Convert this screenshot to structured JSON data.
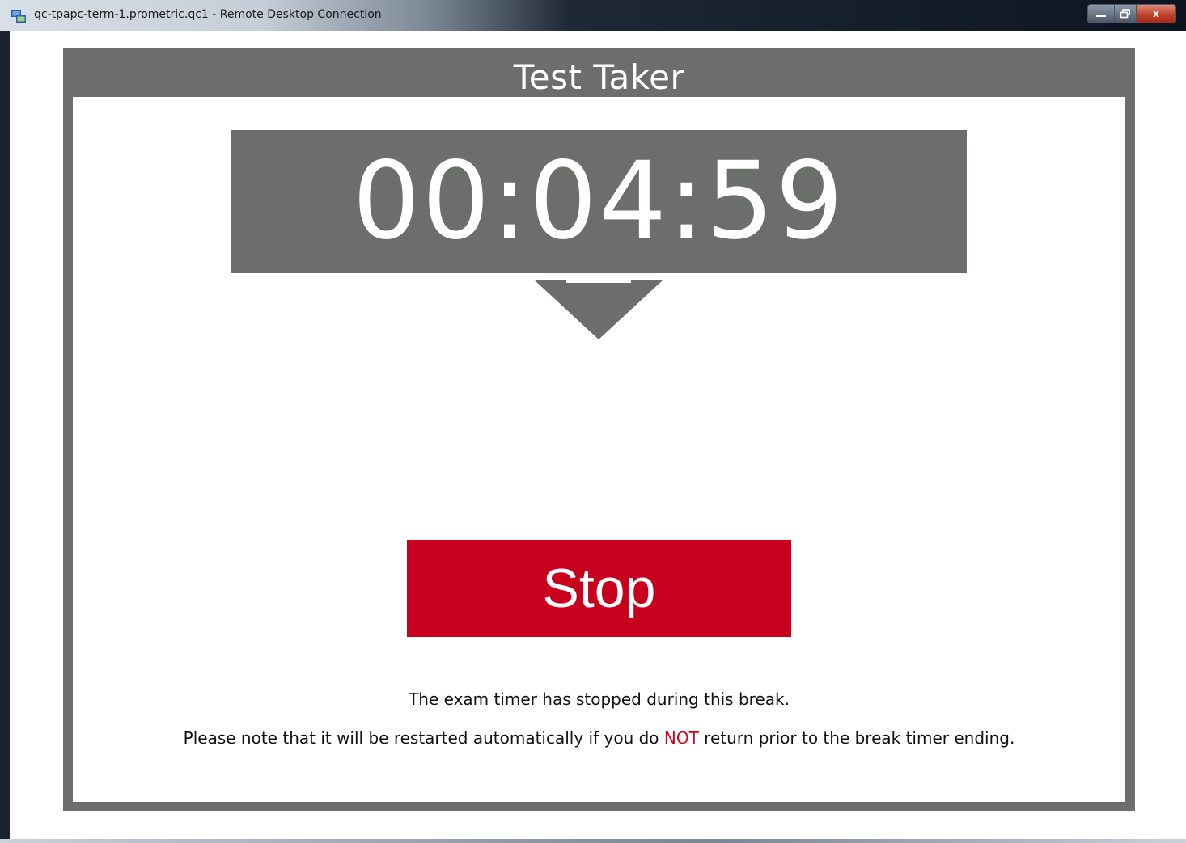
{
  "window": {
    "title": "qc-tpapc-term-1.prometric.qc1 - Remote Desktop Connection",
    "icon": "remote-desktop-icon",
    "controls": {
      "minimize_icon": "minimize-icon",
      "maximize_icon": "restore-icon",
      "close_icon": "close-icon",
      "close_glyph": "x"
    }
  },
  "panel": {
    "title": "Test Taker"
  },
  "timer": {
    "value": "00:04:59",
    "indicator_icon": "down-arrow-icon"
  },
  "actions": {
    "stop_label": "Stop"
  },
  "message": {
    "line1": "The exam timer has stopped during this break.",
    "line2_before": "Please note that it will be restarted automatically if you do ",
    "line2_emphasis": "NOT",
    "line2_after": " return prior to the break timer ending."
  },
  "colors": {
    "panel_gray": "#6c6e6b",
    "stop_red": "#c8001e",
    "emphasis_red": "#d6001c"
  }
}
